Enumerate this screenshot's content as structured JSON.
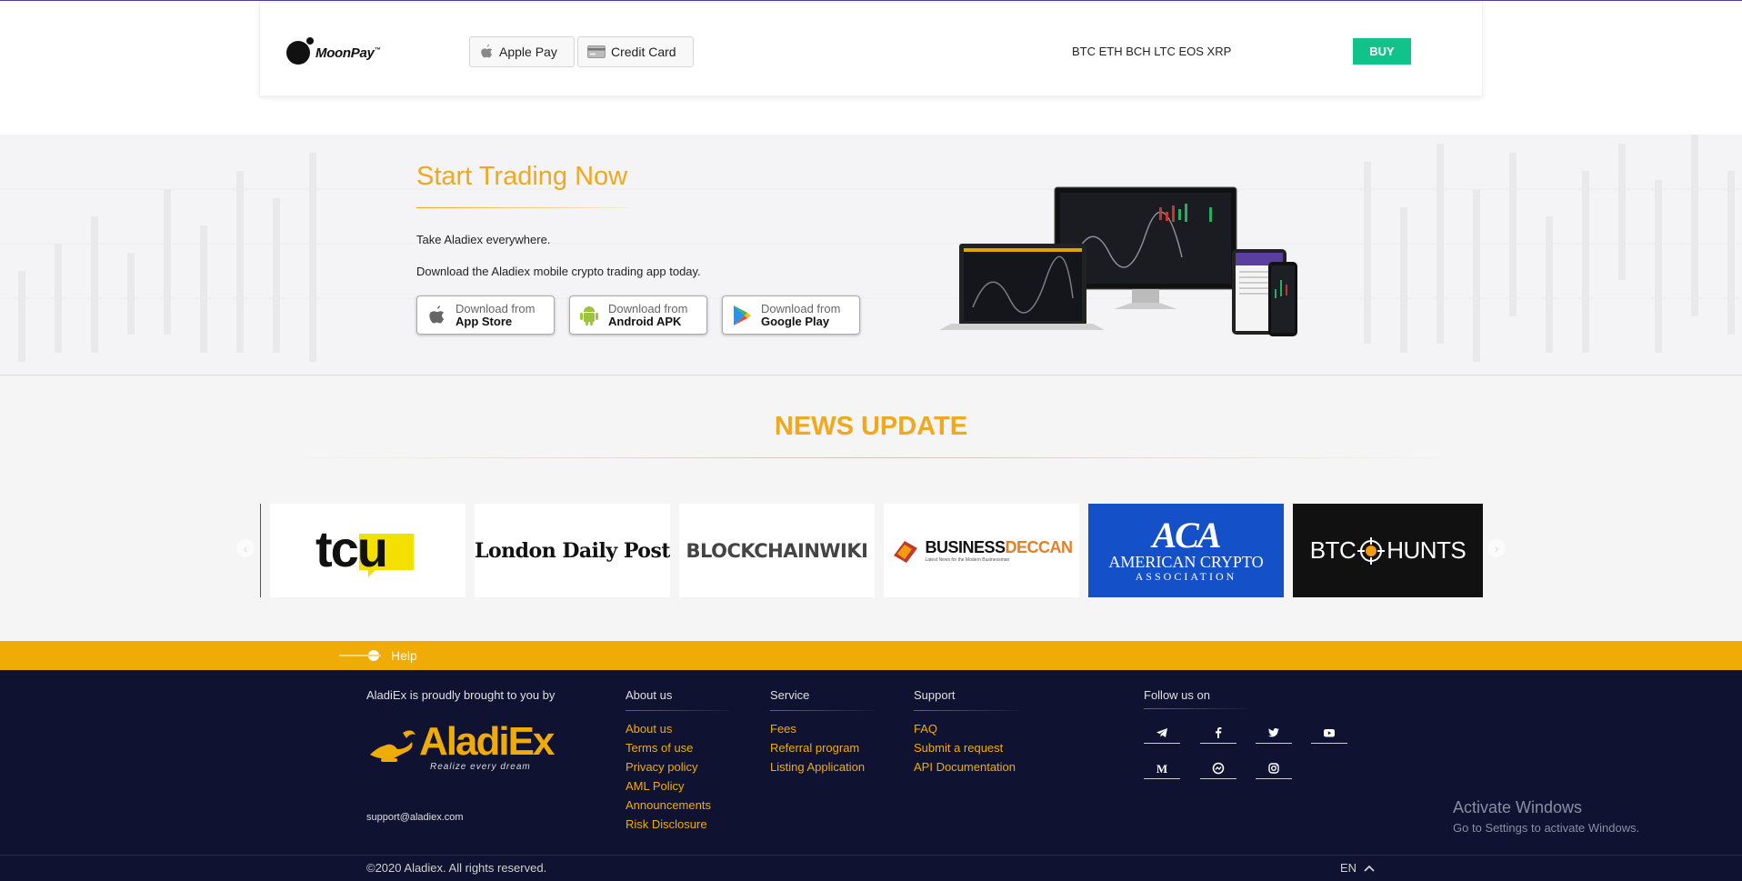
{
  "moonpay": {
    "brand": "MoonPay",
    "trademark": "™",
    "apple_pay_label": "Apple Pay",
    "credit_card_label": "Credit Card",
    "coins": "BTC ETH BCH LTC EOS XRP",
    "buy_label": "BUY"
  },
  "trading": {
    "title": "Start Trading Now",
    "line1": "Take Aladiex everywhere.",
    "line2": "Download the Aladiex mobile crypto trading app today.",
    "buttons": [
      {
        "small": "Download from",
        "big": "App Store",
        "icon": "apple-icon"
      },
      {
        "small": "Download from",
        "big": "Android APK",
        "icon": "android-icon"
      },
      {
        "small": "Download from",
        "big": "Google Play",
        "icon": "google-play-icon"
      }
    ]
  },
  "news": {
    "title": "NEWS UPDATE",
    "logos": [
      {
        "text": "tcu"
      },
      {
        "text": "London Daily Post"
      },
      {
        "text": "BLOCKCHAINWIKI"
      },
      {
        "text": "BUSINESS",
        "text2": "DECCAN",
        "tagline": "Latest News for the Modern Businessman"
      },
      {
        "text": "ACA",
        "text2": "AMERICAN CRYPTO",
        "text3": "ASSOCIATION"
      },
      {
        "text": "BTC",
        "text2": "HUNTS"
      }
    ],
    "prev_arrow": "‹",
    "next_arrow": "›"
  },
  "help": {
    "label": "Help"
  },
  "footer": {
    "brought_by": "AladiEx is proudly brought to you by",
    "logo_name": "AladiEx",
    "logo_tagline": "Realize every dream",
    "email": "support@aladiex.com",
    "columns": [
      {
        "title": "About us",
        "links": [
          "About us",
          "Terms of use",
          "Privacy policy",
          "AML Policy",
          "Announcements",
          "Risk Disclosure"
        ]
      },
      {
        "title": "Service",
        "links": [
          "Fees",
          "Referral program",
          "Listing Application"
        ]
      },
      {
        "title": "Support",
        "links": [
          "FAQ",
          "Submit a request",
          "API Documentation"
        ]
      }
    ],
    "follow_title": "Follow us on",
    "social": [
      "telegram-icon",
      "facebook-icon",
      "twitter-icon",
      "youtube-icon",
      "medium-icon",
      "coinmarketcap-icon",
      "instagram-icon"
    ],
    "copyright": "©2020 Aladiex. All rights reserved.",
    "language": "EN"
  },
  "windows": {
    "activate_title": "Activate Windows",
    "activate_sub": "Go to Settings to activate Windows."
  },
  "colors": {
    "accent": "#f0a81d",
    "buy": "#11c28b",
    "footer_bg": "#0f1231",
    "help_bar": "#f0ac06"
  }
}
